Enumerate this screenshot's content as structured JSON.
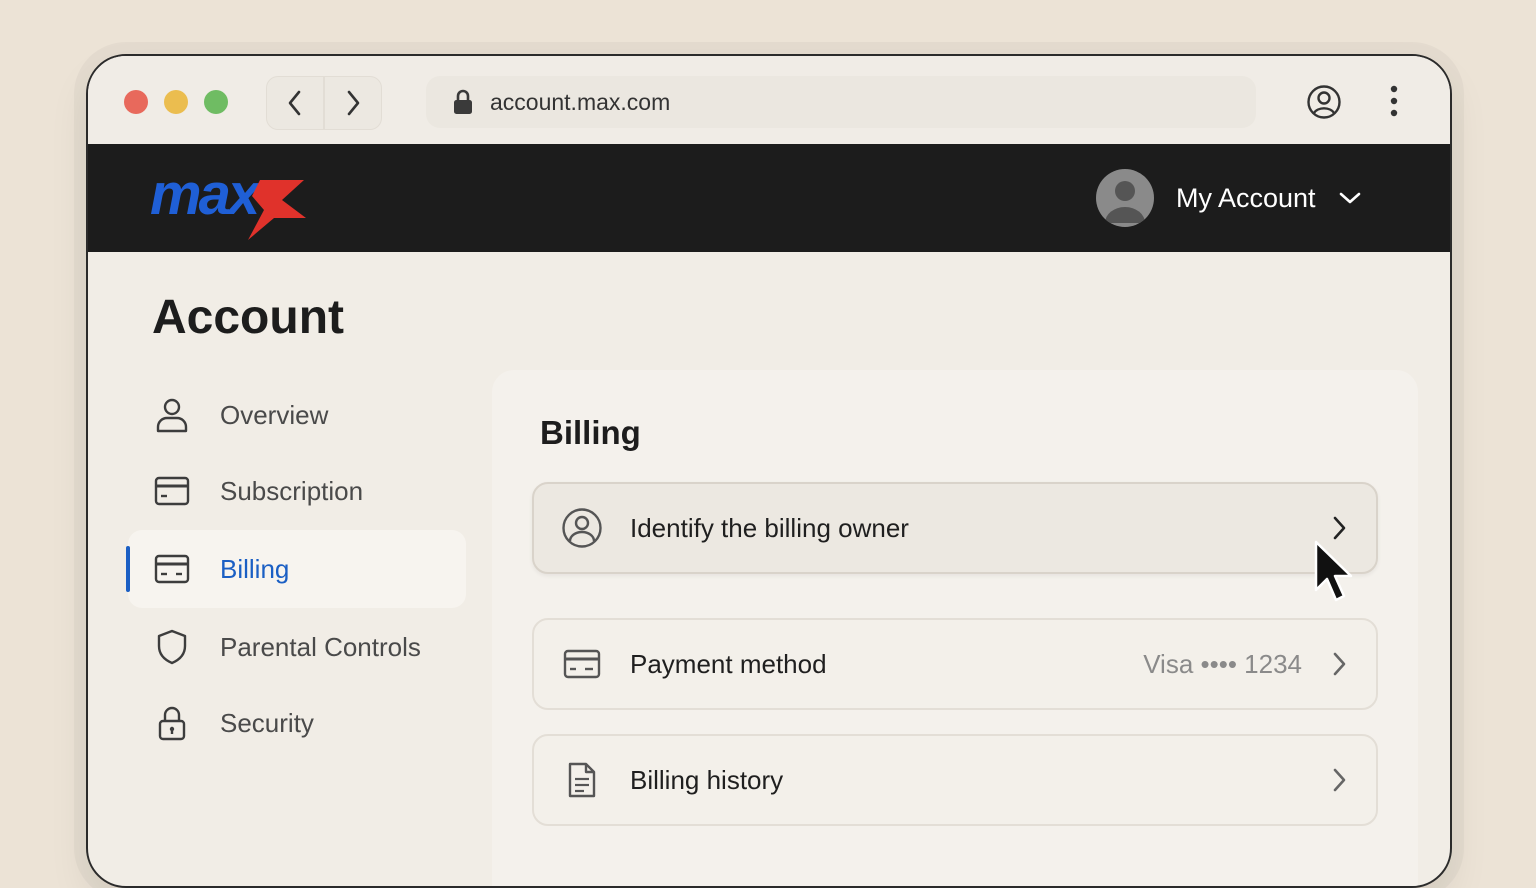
{
  "browser": {
    "url": "account.max.com"
  },
  "header": {
    "logo_text": "max",
    "account_label": "My Account"
  },
  "page": {
    "title": "Account"
  },
  "sidebar": {
    "items": [
      {
        "label": "Overview",
        "icon": "user-icon"
      },
      {
        "label": "Subscription",
        "icon": "card-icon"
      },
      {
        "label": "Billing",
        "icon": "card-icon",
        "active": true
      },
      {
        "label": "Parental Controls",
        "icon": "shield-icon"
      },
      {
        "label": "Security",
        "icon": "lock-icon"
      }
    ]
  },
  "billing": {
    "title": "Billing",
    "rows": [
      {
        "label": "Identify the billing owner",
        "value": "",
        "icon": "user-circle-icon"
      },
      {
        "label": "Payment method",
        "value": "Visa •••• 1234",
        "icon": "card-icon"
      },
      {
        "label": "Billing history",
        "value": "",
        "icon": "document-icon"
      }
    ]
  },
  "colors": {
    "accent": "#1b5fc4",
    "logo_blue": "#1f5fd6",
    "logo_red": "#e0322b",
    "header_bg": "#1c1c1c"
  }
}
